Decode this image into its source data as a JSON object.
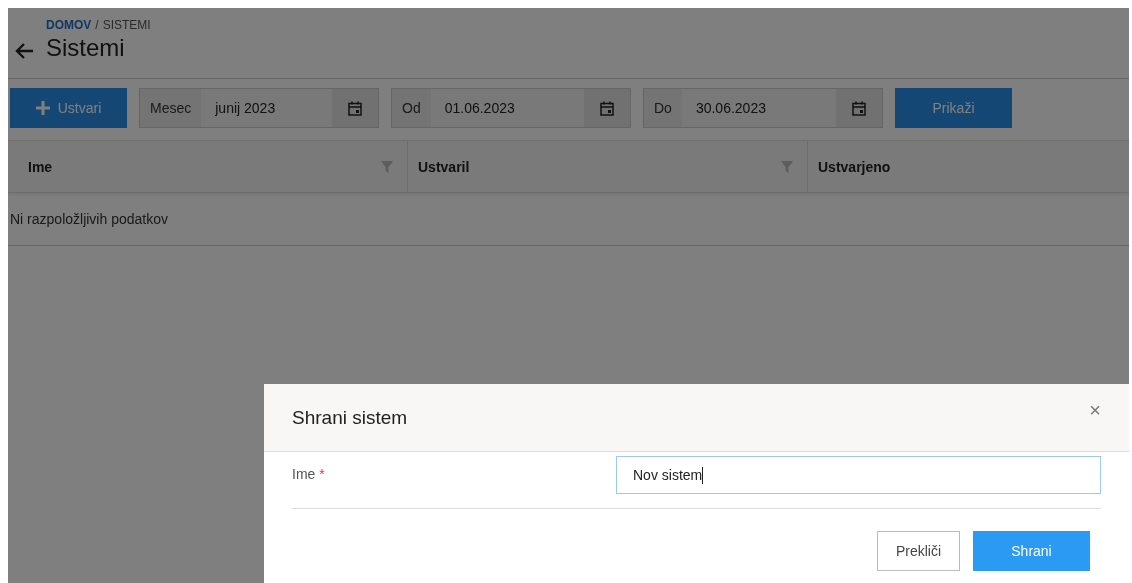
{
  "breadcrumb": [
    {
      "label": "DOMOV",
      "link": true
    },
    {
      "label": "/",
      "link": false
    },
    {
      "label": "SISTEMI",
      "link": false
    }
  ],
  "title": "Sistemi",
  "toolbar": {
    "create_button": "Ustvari",
    "date_fields": [
      {
        "label": "Mesec",
        "value": "junij 2023"
      },
      {
        "label": "Od",
        "value": "01.06.2023"
      },
      {
        "label": "Do",
        "value": "30.06.2023"
      }
    ],
    "show_button": "Prikaži"
  },
  "table": {
    "columns": [
      {
        "label": "Ime",
        "filter": true
      },
      {
        "label": "Ustvaril",
        "filter": true
      },
      {
        "label": "Ustvarjeno",
        "filter": false
      }
    ],
    "empty_message": "Ni razpoložljivih podatkov"
  },
  "dialog": {
    "title": "Shrani sistem",
    "close": "×",
    "fields": [
      {
        "label": "Ime",
        "required_mark": "*",
        "value": "Nov sistem",
        "focused": true
      }
    ],
    "buttons": [
      {
        "label": "Prekliči",
        "kind": "secondary"
      },
      {
        "label": "Shrani",
        "kind": "primary"
      }
    ]
  }
}
